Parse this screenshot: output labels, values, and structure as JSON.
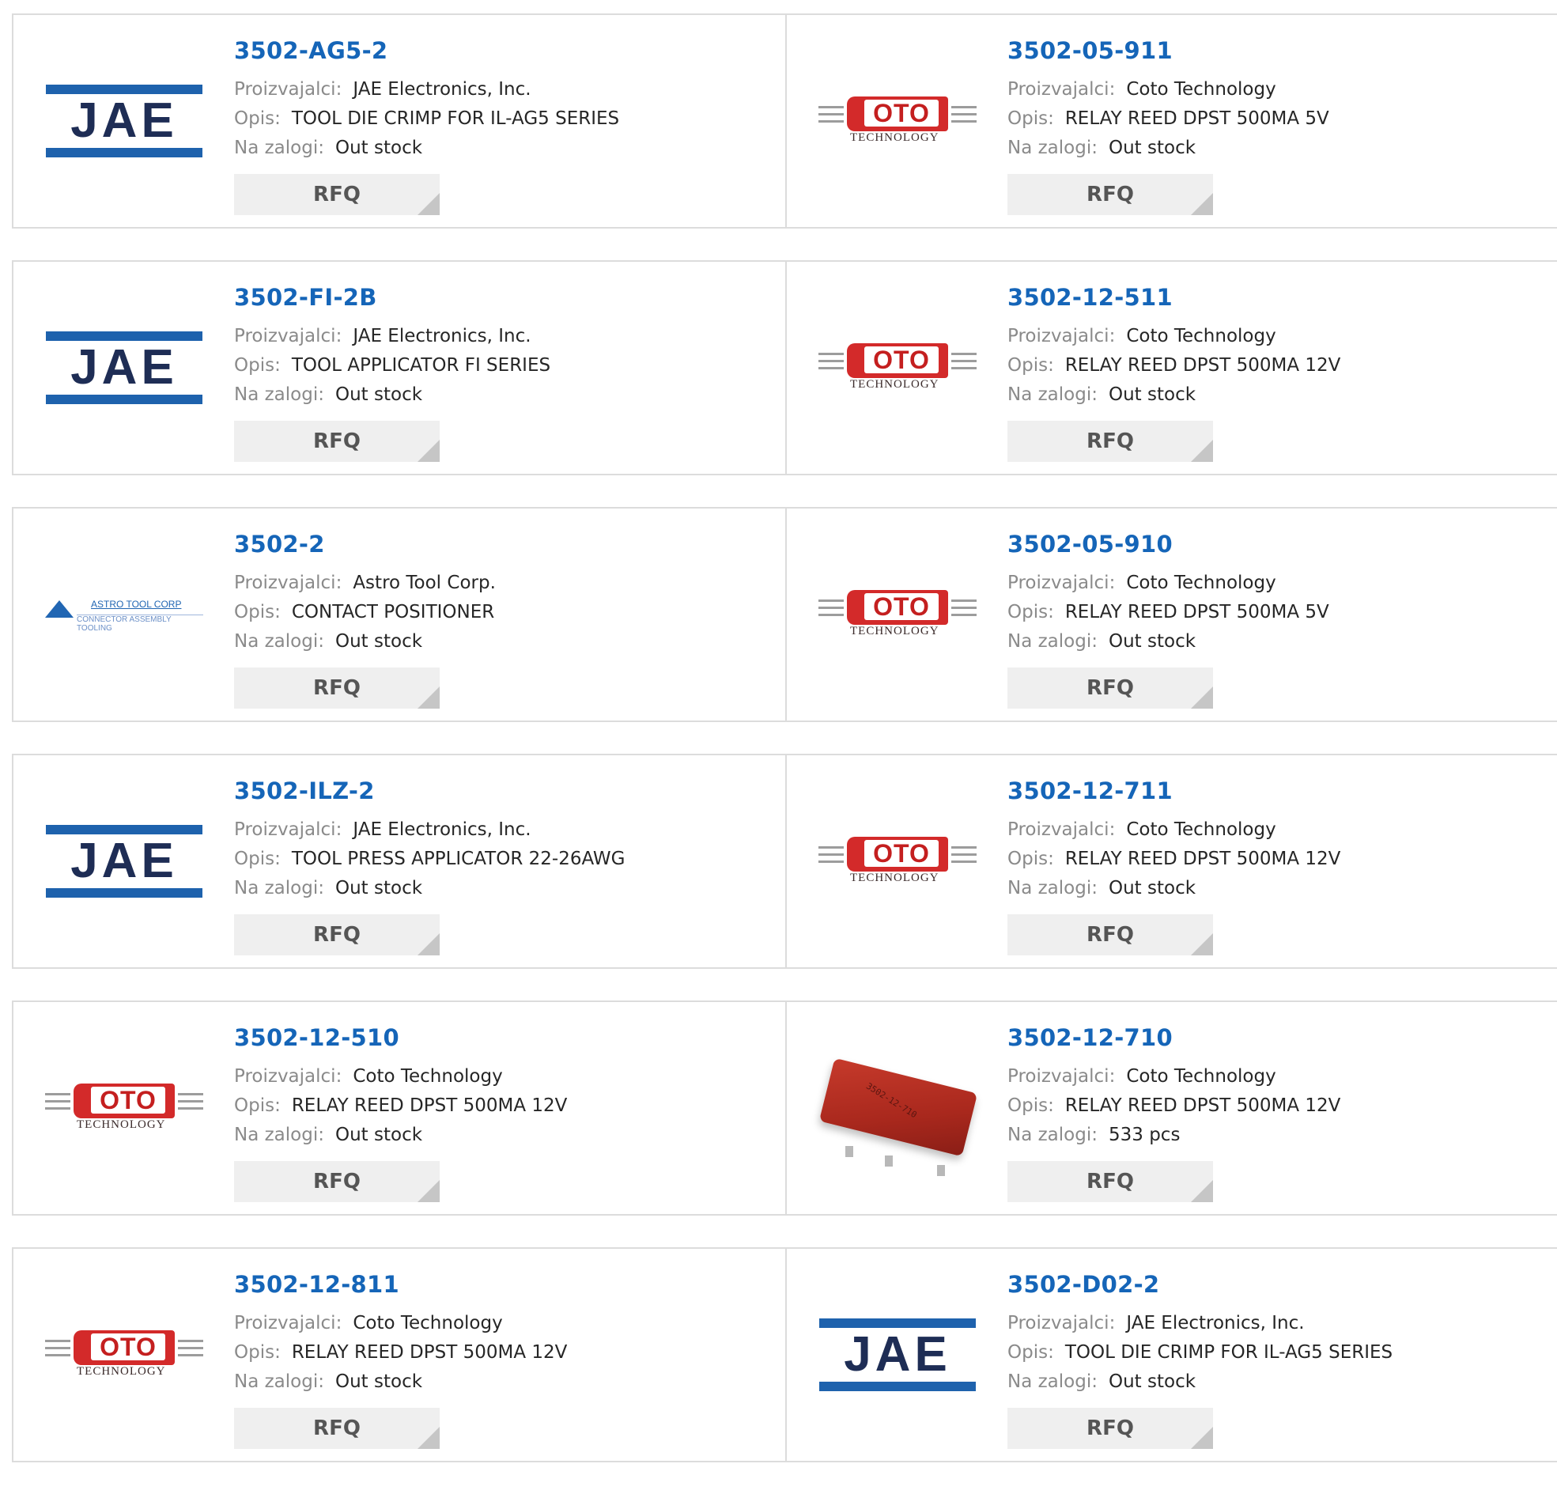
{
  "labels": {
    "manufacturer": "Proizvajalci:",
    "description": "Opis:",
    "stock": "Na zalogi:",
    "rfq": "RFQ"
  },
  "colors": {
    "part_link": "#1565b8",
    "label_gray": "#8a8a8a",
    "jae_blue": "#1e62ad",
    "coto_red": "#d32a2a"
  },
  "logos": {
    "jae": "JAE",
    "coto": "OTO",
    "coto_sub": "TECHNOLOGY",
    "astro_name": "ASTRO TOOL CORP",
    "astro_tag": "CONNECTOR ASSEMBLY TOOLING",
    "relay_print": "3502-12-710"
  },
  "products": [
    {
      "part": "3502-AG5-2",
      "manufacturer": "JAE Electronics, Inc.",
      "description": "TOOL DIE CRIMP FOR IL-AG5 SERIES",
      "stock": "Out stock",
      "logo": "jae"
    },
    {
      "part": "3502-05-911",
      "manufacturer": "Coto Technology",
      "description": "RELAY REED DPST 500MA 5V",
      "stock": "Out stock",
      "logo": "coto"
    },
    {
      "part": "3502-FI-2B",
      "manufacturer": "JAE Electronics, Inc.",
      "description": "TOOL APPLICATOR FI SERIES",
      "stock": "Out stock",
      "logo": "jae"
    },
    {
      "part": "3502-12-511",
      "manufacturer": "Coto Technology",
      "description": "RELAY REED DPST 500MA 12V",
      "stock": "Out stock",
      "logo": "coto"
    },
    {
      "part": "3502-2",
      "manufacturer": "Astro Tool Corp.",
      "description": "CONTACT POSITIONER",
      "stock": "Out stock",
      "logo": "astro"
    },
    {
      "part": "3502-05-910",
      "manufacturer": "Coto Technology",
      "description": "RELAY REED DPST 500MA 5V",
      "stock": "Out stock",
      "logo": "coto"
    },
    {
      "part": "3502-ILZ-2",
      "manufacturer": "JAE Electronics, Inc.",
      "description": "TOOL PRESS APPLICATOR 22-26AWG",
      "stock": "Out stock",
      "logo": "jae"
    },
    {
      "part": "3502-12-711",
      "manufacturer": "Coto Technology",
      "description": "RELAY REED DPST 500MA 12V",
      "stock": "Out stock",
      "logo": "coto"
    },
    {
      "part": "3502-12-510",
      "manufacturer": "Coto Technology",
      "description": "RELAY REED DPST 500MA 12V",
      "stock": "Out stock",
      "logo": "coto"
    },
    {
      "part": "3502-12-710",
      "manufacturer": "Coto Technology",
      "description": "RELAY REED DPST 500MA 12V",
      "stock": "533 pcs",
      "logo": "relay-photo"
    },
    {
      "part": "3502-12-811",
      "manufacturer": "Coto Technology",
      "description": "RELAY REED DPST 500MA 12V",
      "stock": "Out stock",
      "logo": "coto"
    },
    {
      "part": "3502-D02-2",
      "manufacturer": "JAE Electronics, Inc.",
      "description": "TOOL DIE CRIMP FOR IL-AG5 SERIES",
      "stock": "Out stock",
      "logo": "jae"
    }
  ]
}
